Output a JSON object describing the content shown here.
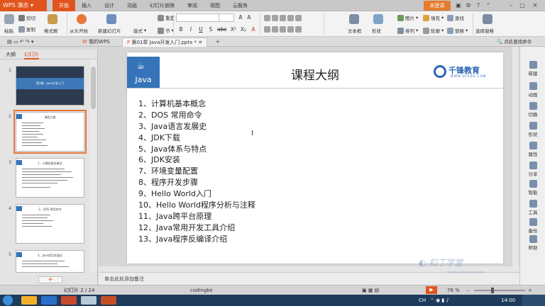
{
  "app": {
    "name": "WPS 演示",
    "login": "未登录",
    "accent": "#e2541d"
  },
  "menu": {
    "tabs": [
      "开始",
      "插入",
      "设计",
      "动画",
      "幻灯片放映",
      "审阅",
      "视图",
      "云服务"
    ],
    "active": 0
  },
  "ribbon": {
    "cut": "剪切",
    "paste": "粘贴",
    "copy": "复制",
    "format_painter": "格式刷",
    "from_start": "从头开始",
    "new_slide": "新建幻灯片",
    "layout": "版式",
    "section": "节",
    "reset": "重置",
    "textbox": "文本框",
    "shape": "形状",
    "arrange": "排列",
    "picture": "图片",
    "fill": "填充",
    "outline": "轮廓",
    "find": "查找",
    "replace": "替换",
    "select_pane": "选择窗格"
  },
  "doc_tabs": {
    "home": "我的WPS",
    "file": "第01章 Java开发入门.pptx *",
    "search_cmd": "点此查找命令"
  },
  "left_panel": {
    "tab_outline": "大纲",
    "tab_slides": "幻灯片",
    "slide_numbers": [
      "1",
      "2",
      "3",
      "4",
      "5"
    ]
  },
  "thumbnails": {
    "s1_title": "第1章：Java开发入门",
    "s2_title": "课程大纲",
    "s3_title": "1、计算机基本概念",
    "s4_title": "2、DOS 常用命令",
    "s5_title": "3、Java语言发展史"
  },
  "slide": {
    "logo_text": "Java",
    "title": "课程大纲",
    "brand_name": "千锋教育",
    "brand_url": "WWW.QFEDU.COM",
    "items": [
      "1、计算机基本概念",
      "2、DOS 常用命令",
      "3、Java语言发展史",
      "4、JDK下载",
      "5、Java体系与特点",
      "6、JDK安装",
      "7、环境变量配置",
      "8、程序开发步骤",
      "9、Hello World入门",
      "10、Hello World程序分析与注释",
      "11、Java跨平台原理",
      "12、Java常用开发工具介绍",
      "13、Java程序反编译介绍"
    ]
  },
  "task_pane": [
    "新建",
    "动画",
    "切换",
    "形状",
    "属性",
    "分享",
    "智能",
    "工具",
    "备份",
    "帮助"
  ],
  "notes_placeholder": "单击此处添加备注",
  "status": {
    "slide_counter": "幻灯片 2 / 24",
    "theme": "codingke",
    "zoom": "76 %"
  },
  "taskbar": {
    "lang": "CH",
    "time": "14:00"
  },
  "watermark": {
    "text": "扣丁学堂",
    "url": "www.codingke.com"
  }
}
